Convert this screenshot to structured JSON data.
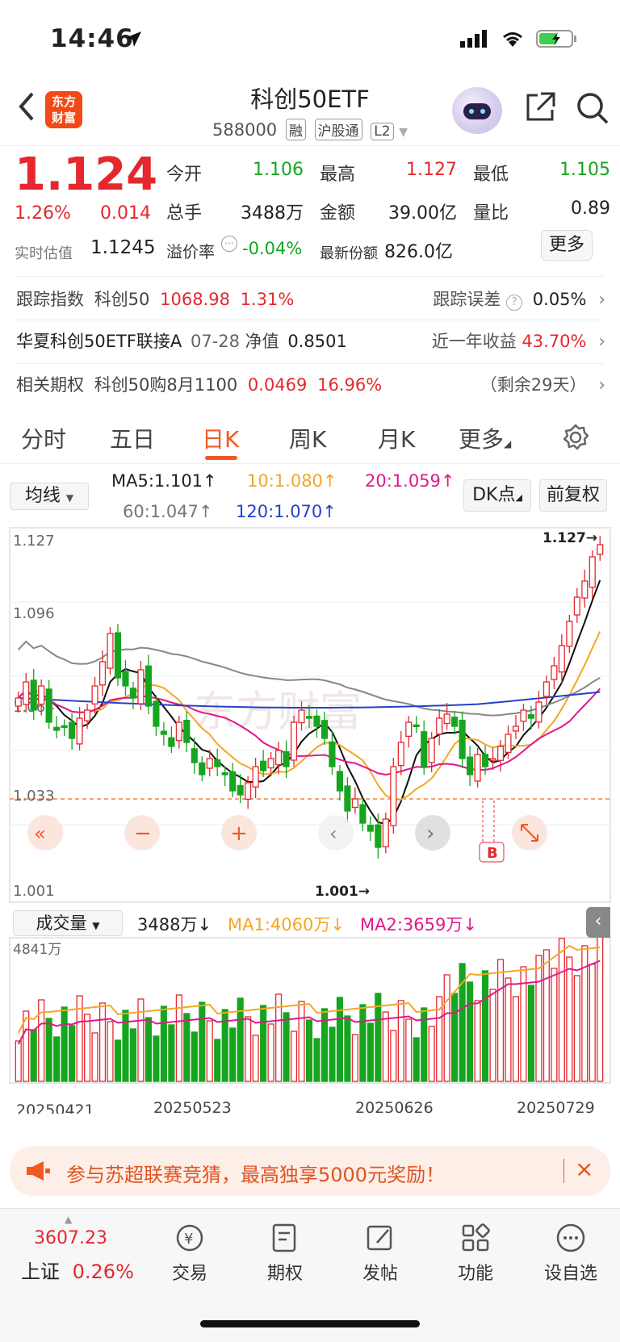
{
  "status_bar": {
    "time": "14:46"
  },
  "header": {
    "logo_line1": "东方",
    "logo_line2": "财富",
    "title": "科创50ETF",
    "code": "588000",
    "tags": [
      "融",
      "沪股通",
      "L2"
    ]
  },
  "quote": {
    "price": "1.124",
    "change_pct": "1.26%",
    "change": "0.014",
    "realtime_label": "实时估值",
    "realtime_value": "1.1245",
    "fields": [
      {
        "label": "今开",
        "value": "1.106"
      },
      {
        "label": "最高",
        "value": "1.127"
      },
      {
        "label": "最低",
        "value": "1.105"
      },
      {
        "label": "总手",
        "value": "3488万"
      },
      {
        "label": "金额",
        "value": "39.00亿"
      },
      {
        "label": "量比",
        "value": "0.89"
      },
      {
        "label": "溢价率",
        "value": "-0.04%"
      },
      {
        "label": "最新份额",
        "value": "826.0亿"
      }
    ],
    "more": "更多"
  },
  "info_rows": {
    "track_label": "跟踪指数",
    "track_name": "科创50",
    "track_value": "1068.98",
    "track_pct": "1.31%",
    "error_label": "跟踪误差",
    "error_value": "0.05%",
    "fund_name": "华夏科创50ETF联接A",
    "fund_date": "07-28",
    "nav_label": "净值",
    "nav_value": "0.8501",
    "year_label": "近一年收益",
    "year_value": "43.70%",
    "option_label": "相关期权",
    "option_name": "科创50购8月1100",
    "option_price": "0.0469",
    "option_pct": "16.96%",
    "option_remaining": "（剩余29天）"
  },
  "tabs": [
    "分时",
    "五日",
    "日K",
    "周K",
    "月K",
    "更多"
  ],
  "chart_controls": {
    "ma_select": "均线",
    "ma5": "MA5:1.101",
    "ma10": "10:1.080",
    "ma20": "20:1.059",
    "ma60": "60:1.047",
    "ma120": "120:1.070",
    "dk_button": "DK点",
    "adjust_button": "前复权",
    "arrow": "↑"
  },
  "chart_data": {
    "type": "candlestick",
    "y_ticks": [
      "1.127",
      "1.096",
      "1.064",
      "1.033",
      "1.001"
    ],
    "ylim": [
      1.001,
      1.127
    ],
    "high_label": "1.127→",
    "low_label": "1.001→",
    "b_marker": "B",
    "dates": [
      "20250421",
      "20250523",
      "20250626",
      "20250729"
    ],
    "volume_select": "成交量",
    "volume_value": "3488万",
    "vol_ma1": "MA1:4060万",
    "vol_ma2": "MA2:3659万",
    "vol_max": "4841万",
    "down_arrow": "↓",
    "watermark": "东方财富"
  },
  "banner": {
    "text": "参与苏超联赛竞猜，最高独享5000元奖励！",
    "close": "×"
  },
  "bottom_bar": {
    "index_value": "3607.23",
    "index_name": "上证",
    "index_pct": "0.26%",
    "items": [
      "交易",
      "期权",
      "发帖",
      "功能",
      "设自选"
    ]
  },
  "colors": {
    "up": "#e5282e",
    "down": "#16a51f",
    "accent": "#f05a22"
  }
}
